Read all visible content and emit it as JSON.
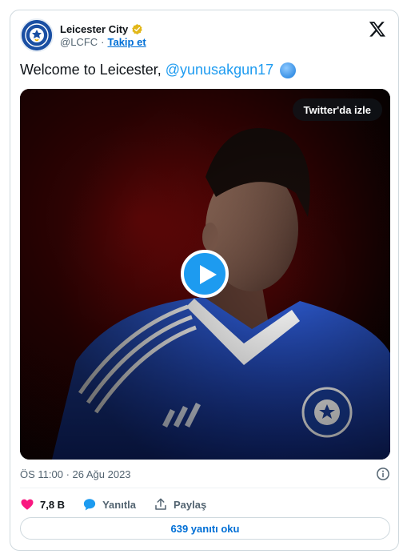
{
  "account": {
    "display_name": "Leicester City",
    "handle": "@LCFC",
    "separator": "·",
    "follow_label": "Takip et"
  },
  "tweet": {
    "text": "Welcome to Leicester,",
    "mention": "@yunusakgun17",
    "emoji": "globe-emoji"
  },
  "media": {
    "watch_label": "Twitter'da izle"
  },
  "meta": {
    "timestamp": "ÖS 11:00 · 26 Ağu 2023"
  },
  "actions": {
    "like_count": "7,8 B",
    "reply_label": "Yanıtla",
    "share_label": "Paylaş"
  },
  "footer": {
    "read_replies_label": "639 yanıtı oku"
  },
  "colors": {
    "accent": "#1d9bf0",
    "link": "#006fd6",
    "like": "#f91880",
    "club_blue": "#1a4fa3"
  }
}
